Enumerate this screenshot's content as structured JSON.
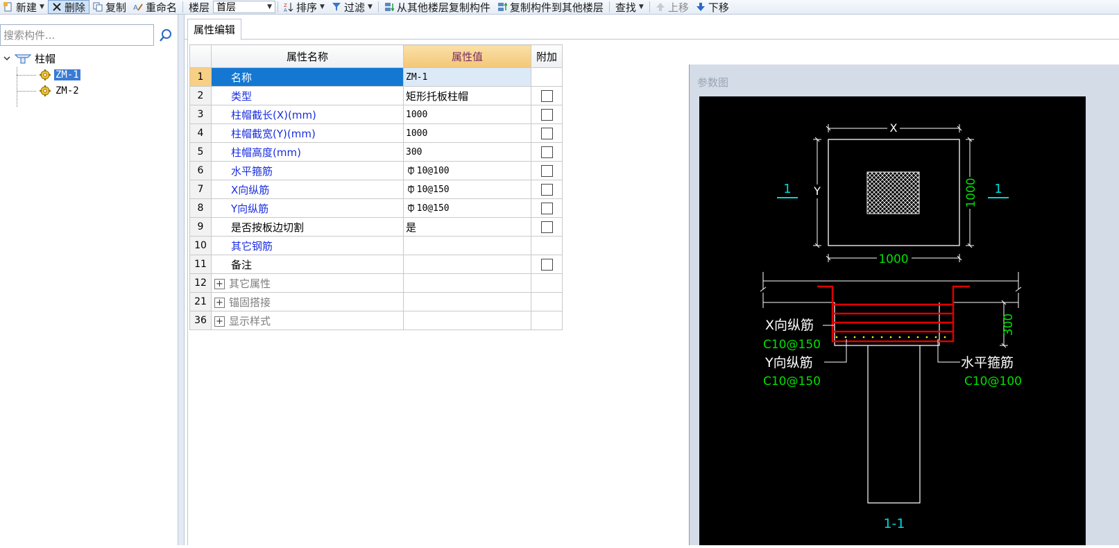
{
  "toolbar": {
    "new_label": "新建",
    "delete_label": "删除",
    "copy_label": "复制",
    "rename_label": "重命名",
    "floor_label": "楼层",
    "floor_value": "首层",
    "sort_label": "排序",
    "filter_label": "过滤",
    "copy_from_floor_label": "从其他楼层复制构件",
    "copy_to_floor_label": "复制构件到其他楼层",
    "find_label": "查找",
    "move_up_label": "上移",
    "move_down_label": "下移"
  },
  "left_panel": {
    "search_placeholder": "搜索构件...",
    "tree": {
      "root_label": "柱帽",
      "children": [
        {
          "label": "ZM-1",
          "selected": true
        },
        {
          "label": "ZM-2",
          "selected": false
        }
      ]
    }
  },
  "tab": {
    "label": "属性编辑"
  },
  "grid": {
    "headers": {
      "name": "属性名称",
      "value": "属性值",
      "extra": "附加"
    },
    "rows": [
      {
        "num": "1",
        "name": "名称",
        "value": "ZM-1"
      },
      {
        "num": "2",
        "name": "类型",
        "value": "矩形托板柱帽"
      },
      {
        "num": "3",
        "name": "柱帽截长(X)(mm)",
        "value": "1000"
      },
      {
        "num": "4",
        "name": "柱帽截宽(Y)(mm)",
        "value": "1000"
      },
      {
        "num": "5",
        "name": "柱帽高度(mm)",
        "value": "300"
      },
      {
        "num": "6",
        "name": "水平箍筋",
        "value": "  10@100"
      },
      {
        "num": "7",
        "name": "X向纵筋",
        "value": "  10@150"
      },
      {
        "num": "8",
        "name": "Y向纵筋",
        "value": "  10@150"
      },
      {
        "num": "9",
        "name": "是否按板边切割",
        "value": "是"
      },
      {
        "num": "10",
        "name": "其它钢筋",
        "value": ""
      },
      {
        "num": "11",
        "name": "备注",
        "value": ""
      },
      {
        "num": "12",
        "name": "其它属性",
        "value": ""
      },
      {
        "num": "21",
        "name": "锚固搭接",
        "value": ""
      },
      {
        "num": "36",
        "name": "显示样式",
        "value": ""
      }
    ]
  },
  "param_panel": {
    "title": "参数图",
    "labels": {
      "x": "X",
      "y": "Y",
      "dim_width": "1000",
      "dim_height": "1000",
      "section_mark_left": "1",
      "section_mark_right": "1",
      "dim_thickness": "300",
      "x_bar_label": "X向纵筋",
      "x_bar_value": "C10@150",
      "y_bar_label": "Y向纵筋",
      "y_bar_value": "C10@150",
      "stirrup_label": "水平箍筋",
      "stirrup_value": "C10@100",
      "section_title": "1-1"
    }
  },
  "colors": {
    "selected_row": "#1478d2",
    "value_header": "#f3c776",
    "cad_background": "#000000",
    "cad_green": "#00e000",
    "cad_cyan": "#00d8d8",
    "cad_red": "#e00000",
    "cad_yellow": "#ffff00"
  }
}
